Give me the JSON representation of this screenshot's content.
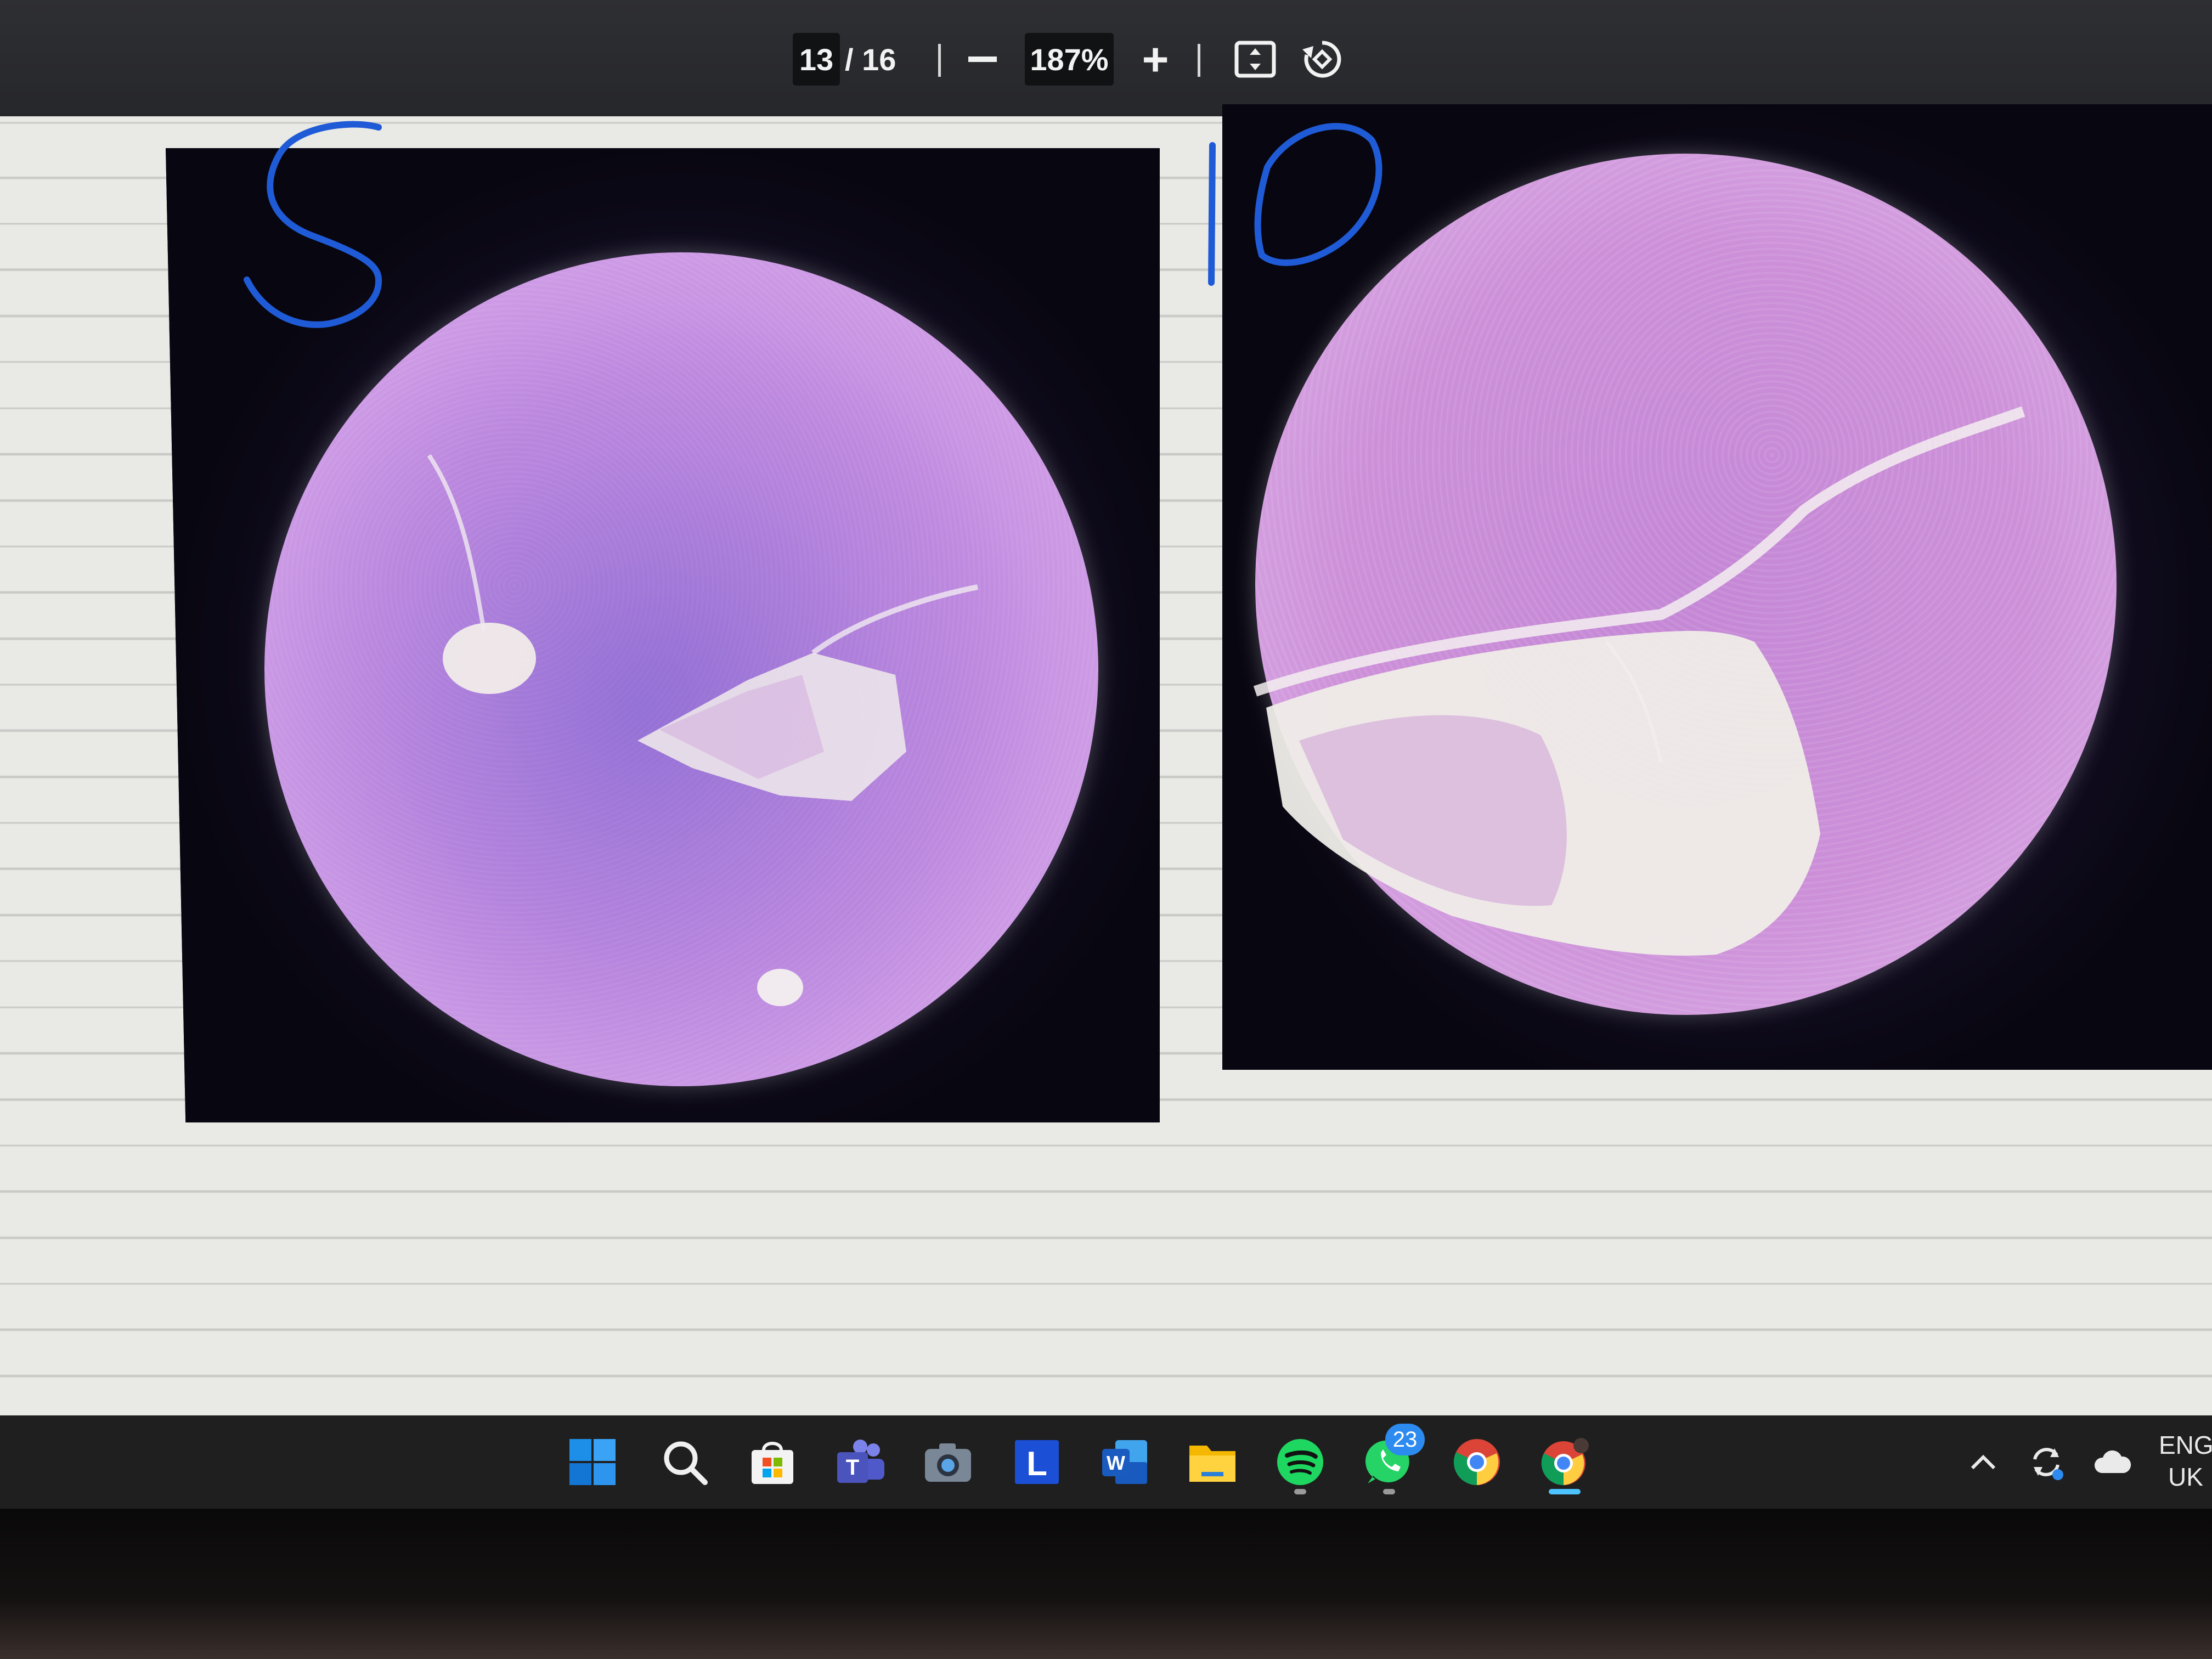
{
  "toolbar": {
    "current_page": "13",
    "page_total": "/ 16",
    "zoom": "187%",
    "zoom_in_label": "+",
    "icons": [
      "zoom-out-icon",
      "zoom-in-icon",
      "fit-page-icon",
      "rotate-icon"
    ]
  },
  "annotations": {
    "left": "S",
    "right": "P",
    "ink_color": "#1f5bd6"
  },
  "taskbar": {
    "apps": [
      "windows-start",
      "search",
      "microsoft-store",
      "teams",
      "camera",
      "l-app",
      "word",
      "file-explorer",
      "spotify",
      "whatsapp",
      "chrome",
      "chrome-profile"
    ],
    "whatsapp_badge": "23",
    "language_line1": "ENG",
    "language_line2": "UK",
    "accent": "#4cc2ff"
  }
}
